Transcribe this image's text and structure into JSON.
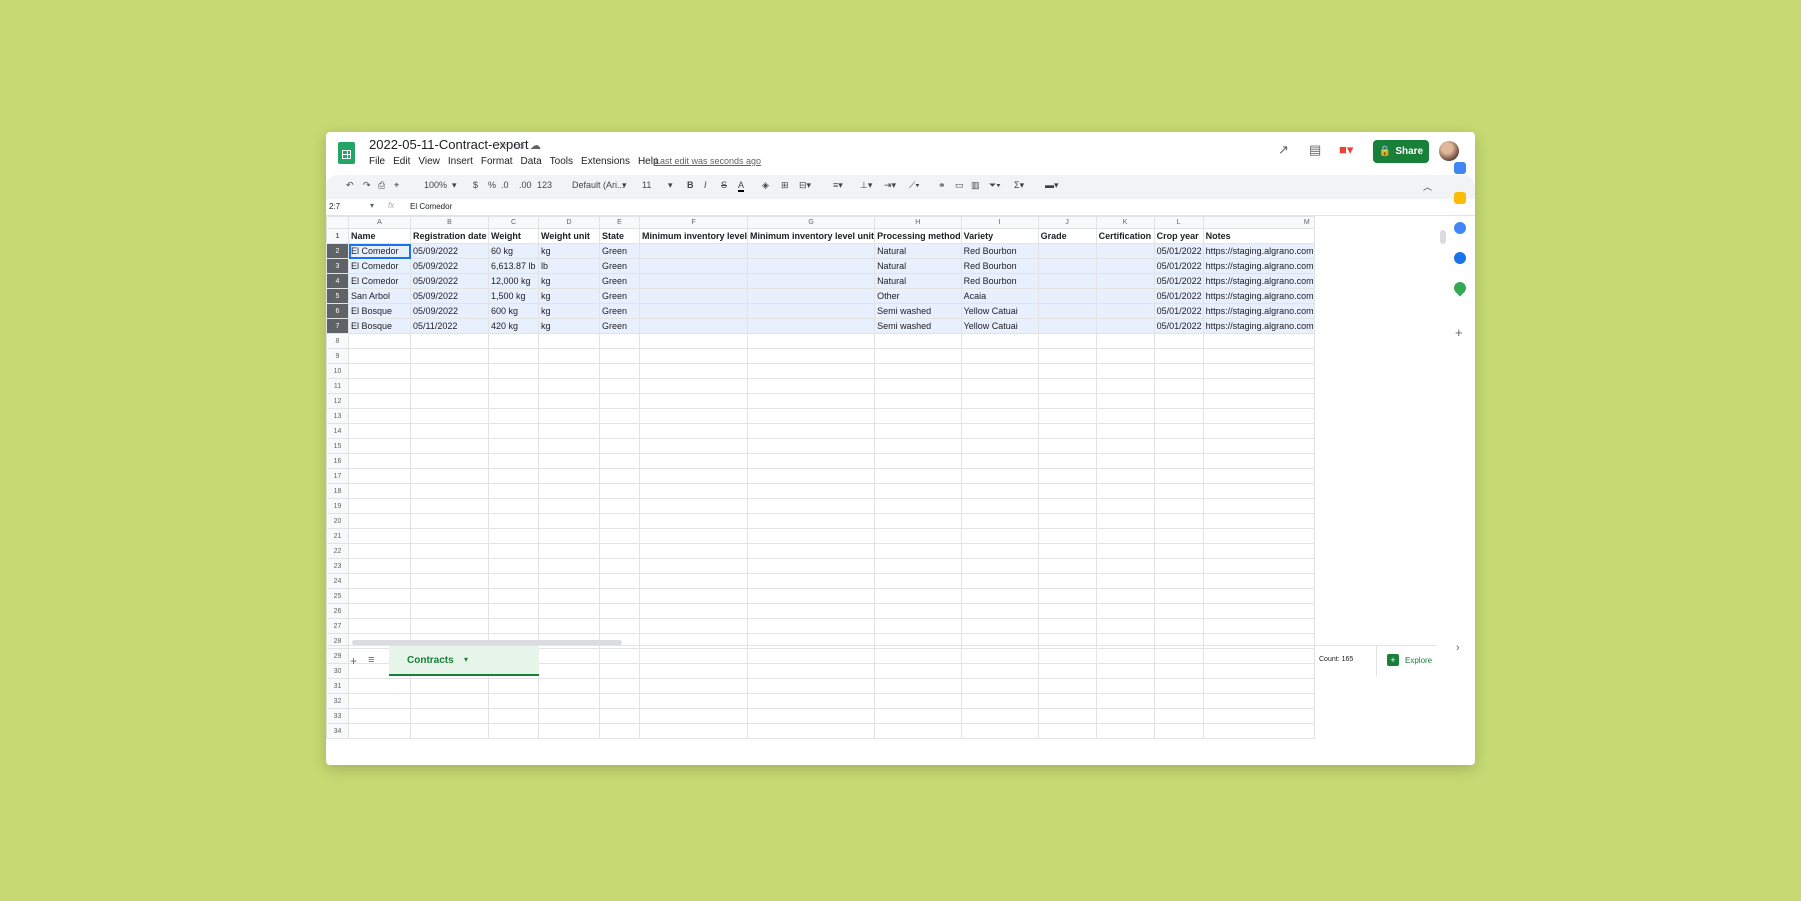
{
  "doc": {
    "title": "2022-05-11-Contract-export",
    "last_edit": "Last edit was seconds ago"
  },
  "menu": [
    "File",
    "Edit",
    "View",
    "Insert",
    "Format",
    "Data",
    "Tools",
    "Extensions",
    "Help"
  ],
  "share_label": "Share",
  "toolbar": {
    "zoom": "100%",
    "currency": "$",
    "percent": "%",
    "dec_decrease": ".0",
    "dec_increase": ".00",
    "more_formats": "123",
    "font": "Default (Ari...",
    "font_size": "11",
    "bold": "B",
    "italic": "I",
    "strike": "S",
    "text_color": "A"
  },
  "formula": {
    "namebox": "2:7",
    "fx": "fx",
    "value": "El Comedor"
  },
  "columns": [
    "A",
    "B",
    "C",
    "D",
    "E",
    "F",
    "G",
    "H",
    "I",
    "J",
    "K",
    "L",
    "M"
  ],
  "headers": [
    "Name",
    "Registration date",
    "Weight",
    "Weight unit",
    "State",
    "Minimum inventory level",
    "Minimum inventory level unit",
    "Processing method",
    "Variety",
    "Grade",
    "Certification",
    "Crop year",
    "Notes"
  ],
  "rows": [
    [
      "El Comedor",
      "05/09/2022",
      "60 kg",
      "kg",
      "Green",
      "",
      "",
      "Natural",
      "Red Bourbon",
      "",
      "",
      "05/01/2022",
      "https://staging.algrano.com"
    ],
    [
      "El Comedor",
      "05/09/2022",
      "6,613.87 lb",
      "lb",
      "Green",
      "",
      "",
      "Natural",
      "Red Bourbon",
      "",
      "",
      "05/01/2022",
      "https://staging.algrano.com"
    ],
    [
      "El Comedor",
      "05/09/2022",
      "12,000 kg",
      "kg",
      "Green",
      "",
      "",
      "Natural",
      "Red Bourbon",
      "",
      "",
      "05/01/2022",
      "https://staging.algrano.com"
    ],
    [
      "San Arbol",
      "05/09/2022",
      "1,500 kg",
      "kg",
      "Green",
      "",
      "",
      "Other",
      "Acaia",
      "",
      "",
      "05/01/2022",
      "https://staging.algrano.com"
    ],
    [
      "El Bosque",
      "05/09/2022",
      "600 kg",
      "kg",
      "Green",
      "",
      "",
      "Semi washed",
      "Yellow Catuai",
      "",
      "",
      "05/01/2022",
      "https://staging.algrano.com"
    ],
    [
      "El Bosque",
      "05/11/2022",
      "420 kg",
      "kg",
      "Green",
      "",
      "",
      "Semi washed",
      "Yellow Catuai",
      "",
      "",
      "05/01/2022",
      "https://staging.algrano.com"
    ]
  ],
  "empty_rows": [
    "8",
    "9",
    "10",
    "11",
    "12",
    "13",
    "14",
    "15",
    "16",
    "17",
    "18",
    "19",
    "20",
    "21",
    "22",
    "23",
    "24",
    "25",
    "26",
    "27",
    "28",
    "29",
    "30",
    "31",
    "32",
    "33",
    "34"
  ],
  "sheet_tab": "Contracts",
  "count": "Count: 165",
  "explore": "Explore",
  "colors": {
    "accent": "#188038",
    "selection": "#e8f0fe",
    "active_border": "#1a73e8"
  }
}
